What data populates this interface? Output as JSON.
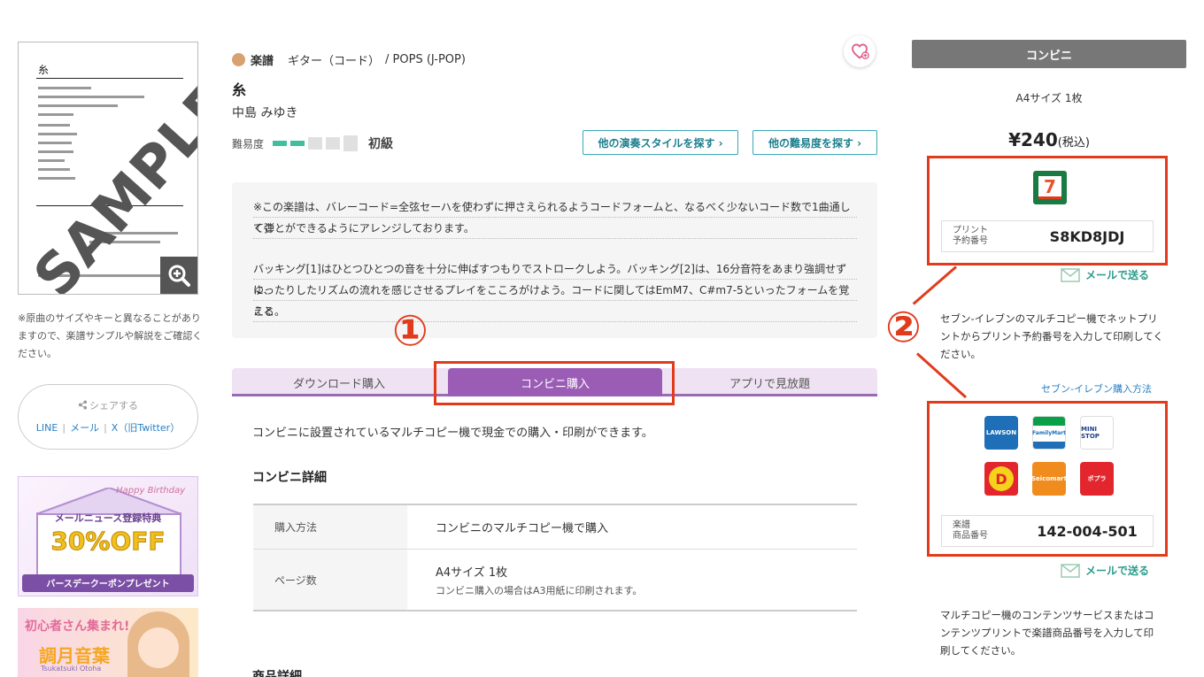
{
  "thumbnail": {
    "title_mini": "糸",
    "sample_text": "SAMPLE"
  },
  "left_note": "※原曲のサイズやキーと異なることがありますので、楽譜サンプルや解説をご確認ください。",
  "share": {
    "title": "シェアする",
    "links": [
      "LINE",
      "メール",
      "X（旧Twitter）"
    ]
  },
  "banner1": {
    "top": "Happy Birthday",
    "heading": "メールニュース登録特典",
    "big": "30%OFF",
    "bottom": "バースデークーポンプレゼント"
  },
  "banner2": {
    "heading": "初心者さん集まれ!",
    "name": "調月音葉",
    "romaji": "Tsukatsuki Otoha"
  },
  "breadcrumb": {
    "category": "楽譜",
    "instrument": "ギター（コード）",
    "genre": "/ POPS (J-POP)"
  },
  "song": {
    "title": "糸",
    "artist": "中島 みゆき"
  },
  "difficulty": {
    "label": "難易度",
    "level_text": "初級",
    "level": 2,
    "max": 5
  },
  "buttons": {
    "other_style": "他の演奏スタイルを探す ›",
    "other_difficulty": "他の難易度を探す ›"
  },
  "description": {
    "para1_line1": "※この楽譜は、バレーコード=全弦セーハを使わずに押さえられるようコードフォームと、なるべく少ないコード数で1曲通して弾",
    "para1_line2": "くことができるようにアレンジしております。",
    "para2_line1": "バッキング[1]はひとつひとつの音を十分に伸ばすつもりでストロークしよう。バッキング[2]は、16分音符をあまり強調せずに、",
    "para2_line2": "ゆったりしたリズムの流れを感じさせるプレイをこころがけよう。コードに関してはEmM7、C#m7-5といったフォームを覚える",
    "para2_line3": "こと。"
  },
  "annotations": {
    "one": "①",
    "two": "②"
  },
  "tabs": [
    "ダウンロード購入",
    "コンビニ購入",
    "アプリで見放題"
  ],
  "active_tab": 1,
  "intro": "コンビニに設置されているマルチコピー機で現金での購入・印刷ができます。",
  "detail_title": "コンビニ詳細",
  "details": [
    {
      "label": "購入方法",
      "value": "コンビニのマルチコピー機で購入",
      "note": ""
    },
    {
      "label": "ページ数",
      "value": "A4サイズ 1枚",
      "note": "コンビニ購入の場合はA3用紙に印刷されます。"
    }
  ],
  "product_detail_title": "商品詳細",
  "right": {
    "header": "コンビニ",
    "size": "A4サイズ 1枚",
    "price": "¥240",
    "tax": "(税込)",
    "seven": {
      "code_label_line1": "プリント",
      "code_label_line2": "予約番号",
      "code": "S8KD8JDJ",
      "mail": "メールで送る",
      "note": "セブン-イレブンのマルチコピー機でネットプリントからプリント予約番号を入力して印刷してください。",
      "howto": "セブン-イレブン購入方法"
    },
    "others": {
      "stores": [
        {
          "name": "LAWSON STATION",
          "color": "#1e6fb8"
        },
        {
          "name": "FamilyMart",
          "color": "#ffffff"
        },
        {
          "name": "MINI STOP",
          "color": "#ffffff"
        },
        {
          "name": "Daily",
          "color": "#e3262d"
        },
        {
          "name": "Seicomart",
          "color": "#f08c1e"
        },
        {
          "name": "ポプラ",
          "color": "#e3262d"
        }
      ],
      "code_label_line1": "楽譜",
      "code_label_line2": "商品番号",
      "code": "142-004-501",
      "mail": "メールで送る",
      "note": "マルチコピー機のコンテンツサービスまたはコンテンツプリントで楽譜商品番号を入力して印刷してください。"
    }
  },
  "colors": {
    "accent_purple": "#9b5cb5",
    "annotation_red": "#e23b1c",
    "teal": "#3aa7b8"
  }
}
